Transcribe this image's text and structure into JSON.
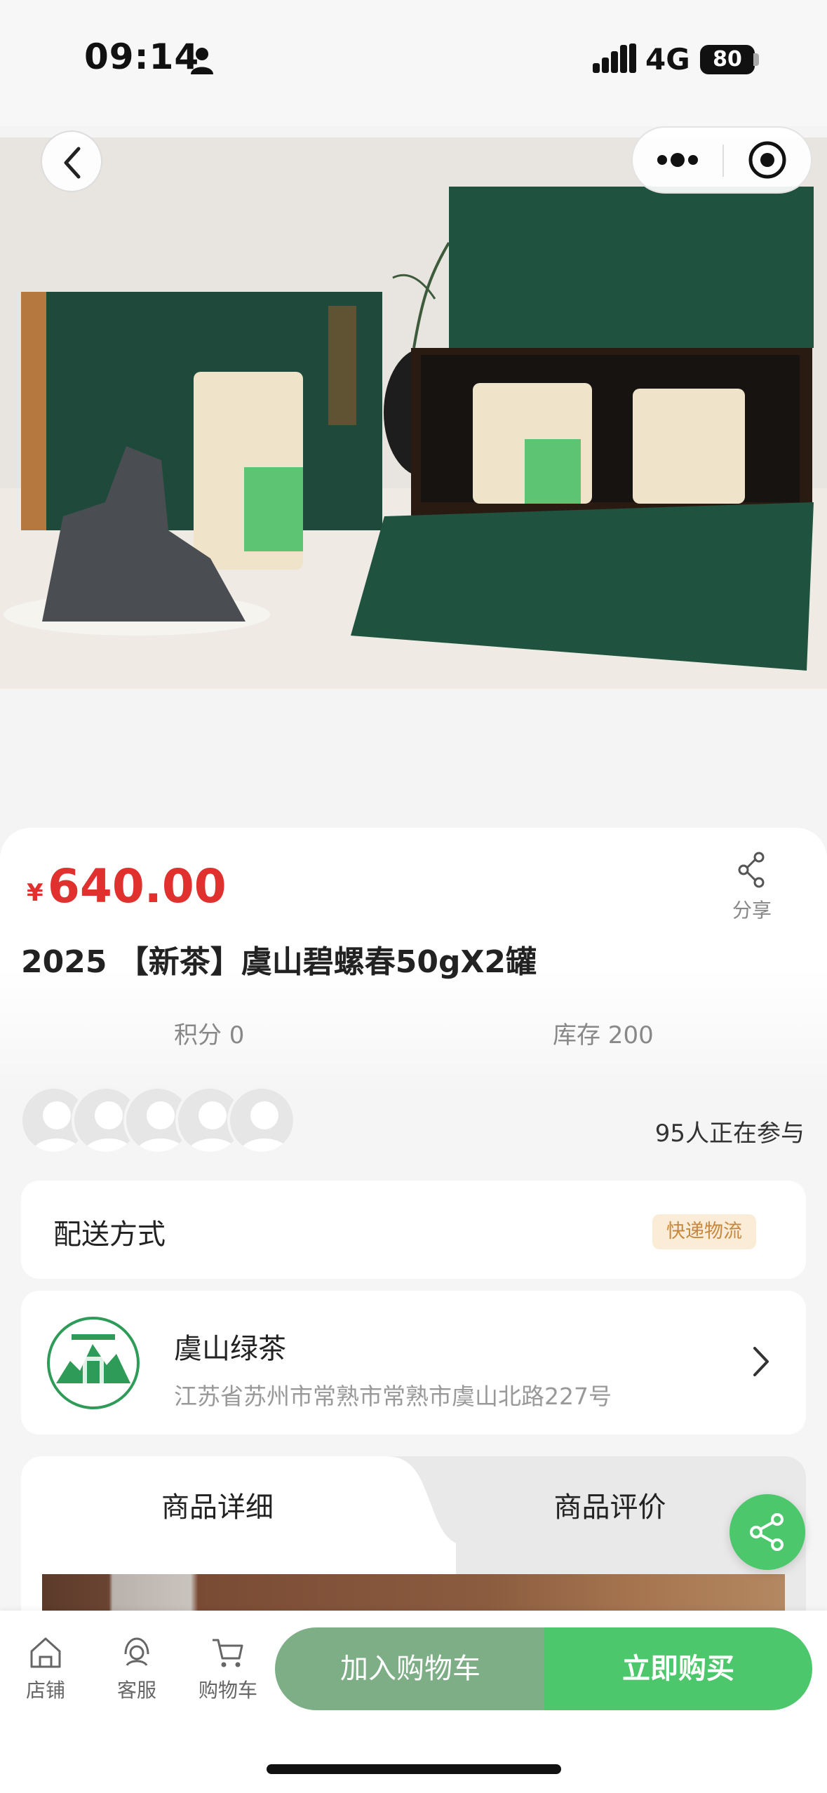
{
  "status_bar": {
    "time": "09:14",
    "network": "4G",
    "battery": "80",
    "icons": [
      "person-icon",
      "signal-icon",
      "battery-icon"
    ]
  },
  "nav": {
    "icons": [
      "back-icon",
      "more-icon",
      "record-icon"
    ]
  },
  "product": {
    "price_symbol": "¥",
    "price": "640.00",
    "share_label": "分享",
    "title": "2025 【新茶】虞山碧螺春50gX2罐",
    "points": "积分 0",
    "stock": "库存 200",
    "participants": "95人正在参与"
  },
  "delivery": {
    "label": "配送方式",
    "method": "快递物流"
  },
  "store": {
    "name": "虞山绿茶",
    "address": "江苏省苏州市常熟市常熟市虞山北路227号"
  },
  "tabs": [
    {
      "label": "商品详细",
      "active": true
    },
    {
      "label": "商品评价",
      "active": false
    }
  ],
  "bottom_bar": {
    "nav_items": [
      {
        "label": "店铺",
        "icon": "store-icon"
      },
      {
        "label": "客服",
        "icon": "customer-service-icon"
      },
      {
        "label": "购物车",
        "icon": "cart-icon"
      }
    ],
    "add_to_cart": "加入购物车",
    "buy_now": "立即购买"
  },
  "colors": {
    "price": "#e0312f",
    "brand_green": "#4cc76b",
    "muted_green": "#7dae86",
    "badge_bg": "#fbecd8",
    "badge_text": "#c7893e"
  }
}
